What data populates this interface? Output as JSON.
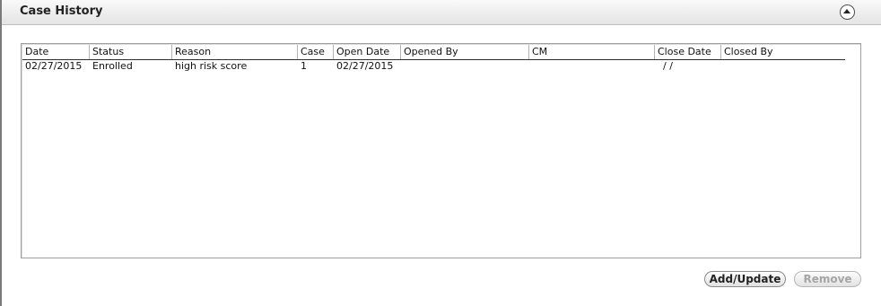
{
  "section": {
    "title": "Case History"
  },
  "table": {
    "columns": [
      "Date",
      "Status",
      "Reason",
      "Case",
      "Open Date",
      "Opened By",
      "CM",
      "Close Date",
      "Closed By"
    ],
    "rows": [
      {
        "date": "02/27/2015",
        "status": "Enrolled",
        "reason": "high risk score",
        "case": "1",
        "open_date": "02/27/2015",
        "opened_by": "",
        "cm": "",
        "close_date": "/ /",
        "closed_by": ""
      }
    ]
  },
  "buttons": {
    "add_update": "Add/Update",
    "remove": "Remove"
  },
  "icons": {
    "collapse": "collapse-up-icon"
  }
}
